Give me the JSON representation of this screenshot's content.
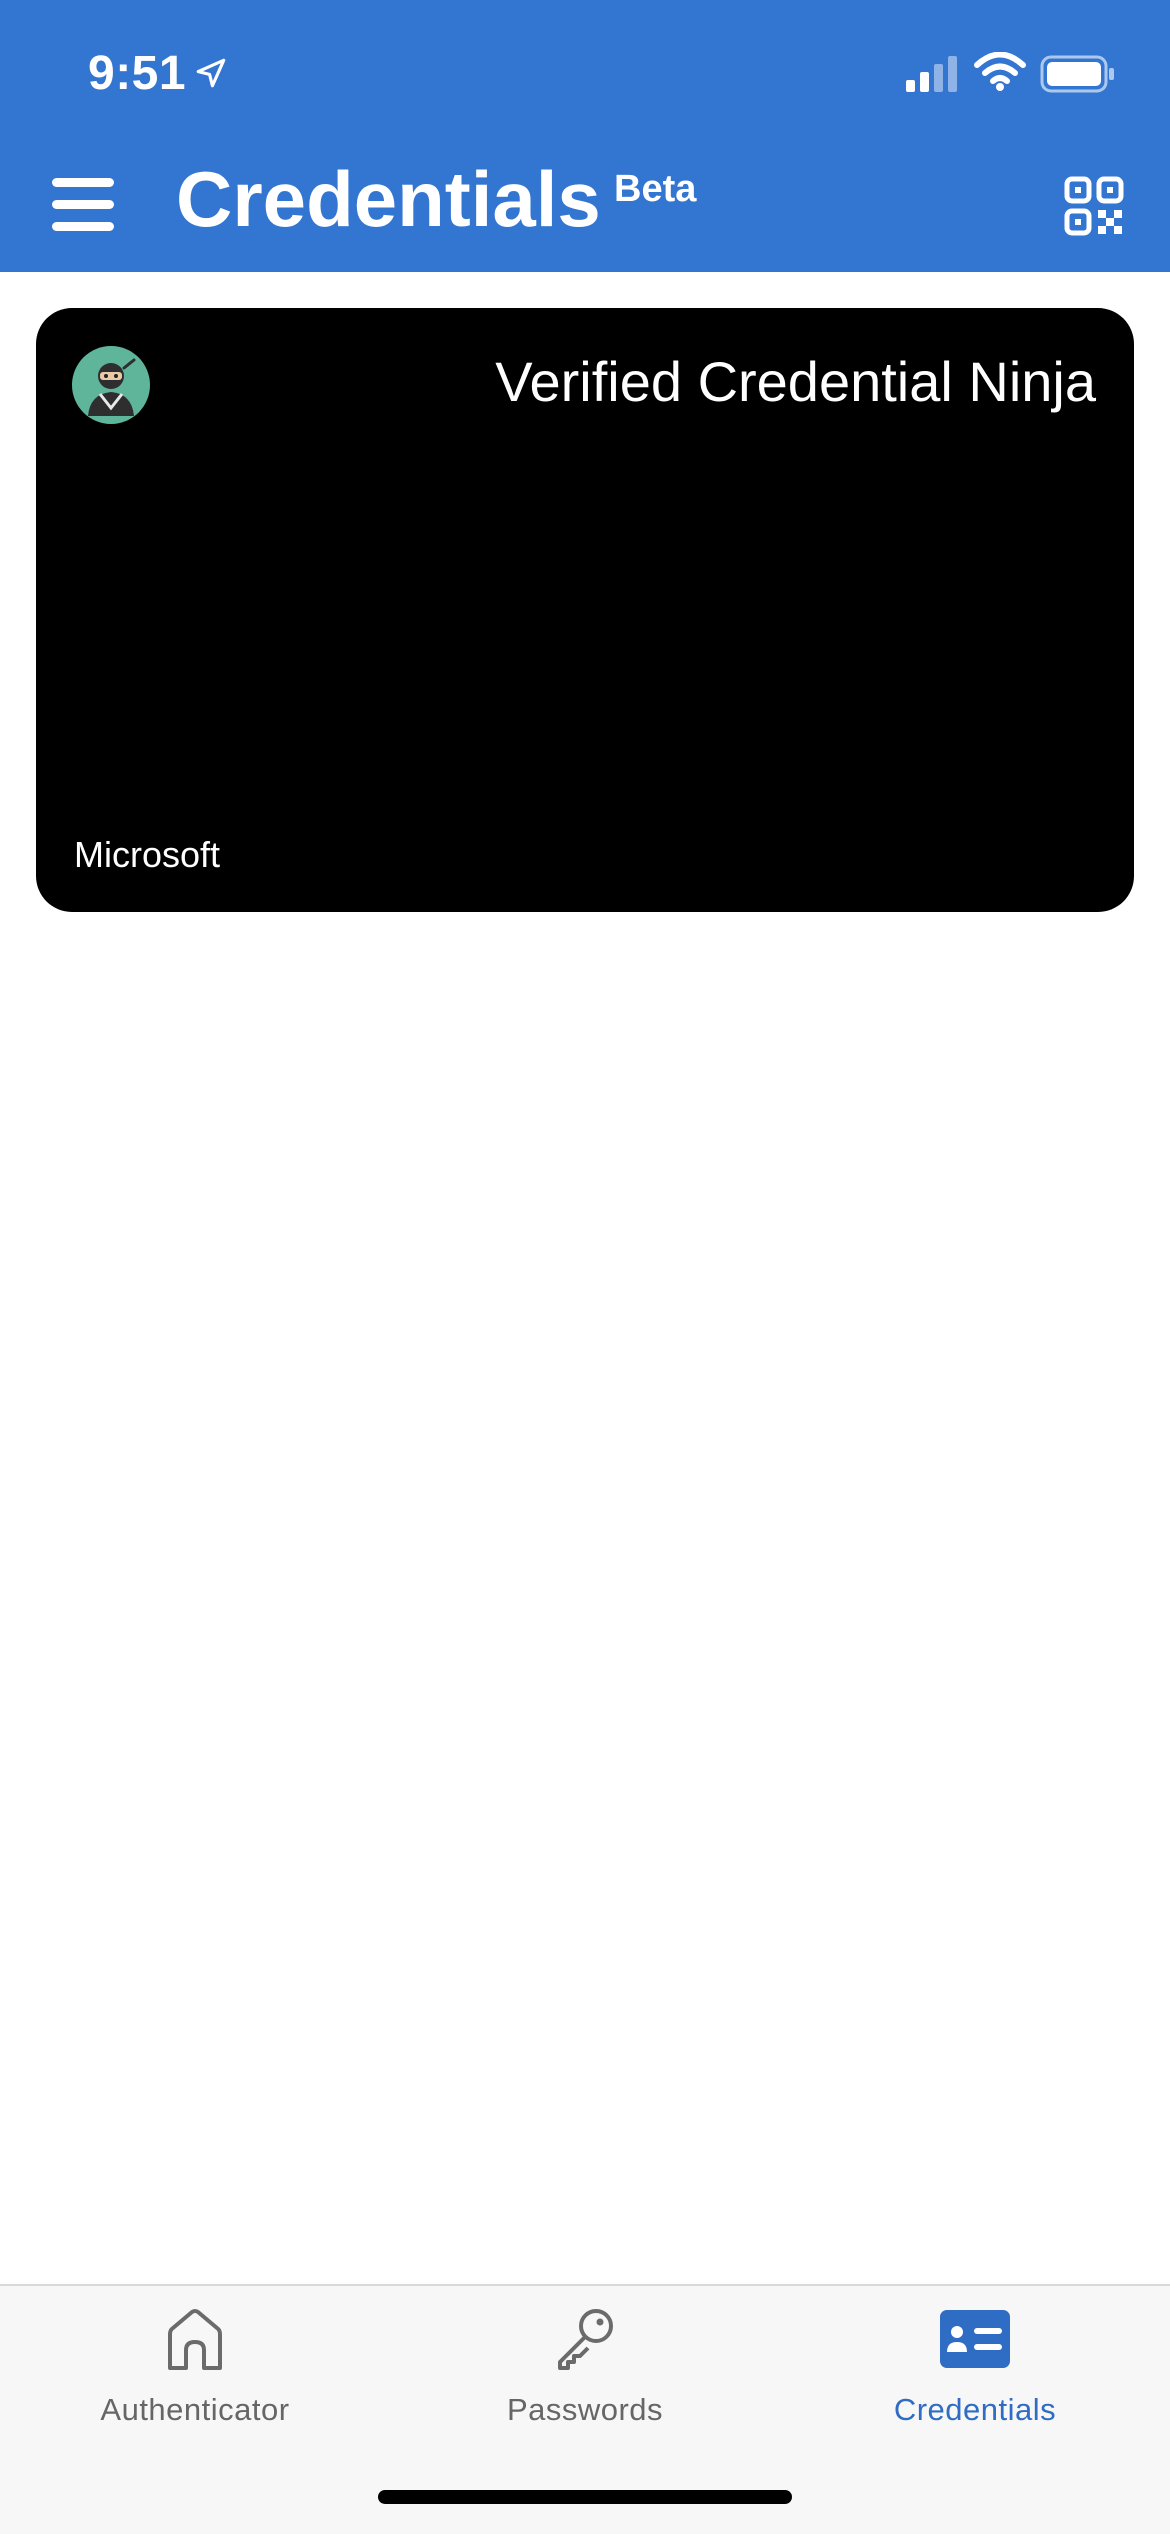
{
  "status_bar": {
    "time": "9:51",
    "icons": [
      "location-arrow-icon",
      "cellular-signal-icon",
      "wifi-icon",
      "battery-icon"
    ]
  },
  "app_bar": {
    "title": "Credentials",
    "badge": "Beta",
    "menu_icon": "hamburger-menu-icon",
    "action_icon": "qr-code-icon",
    "background": "#3376D1"
  },
  "credential_card": {
    "title": "Verified Credential Ninja",
    "issuer": "Microsoft",
    "logo_icon": "ninja-avatar-icon",
    "background": "#000000",
    "logo_background": "#5FB59A"
  },
  "tab_bar": {
    "tabs": [
      {
        "label": "Authenticator",
        "icon": "home-icon",
        "selected": false
      },
      {
        "label": "Passwords",
        "icon": "key-icon",
        "selected": false
      },
      {
        "label": "Credentials",
        "icon": "id-card-icon",
        "selected": true
      }
    ],
    "accent": "#2F6CC4"
  }
}
